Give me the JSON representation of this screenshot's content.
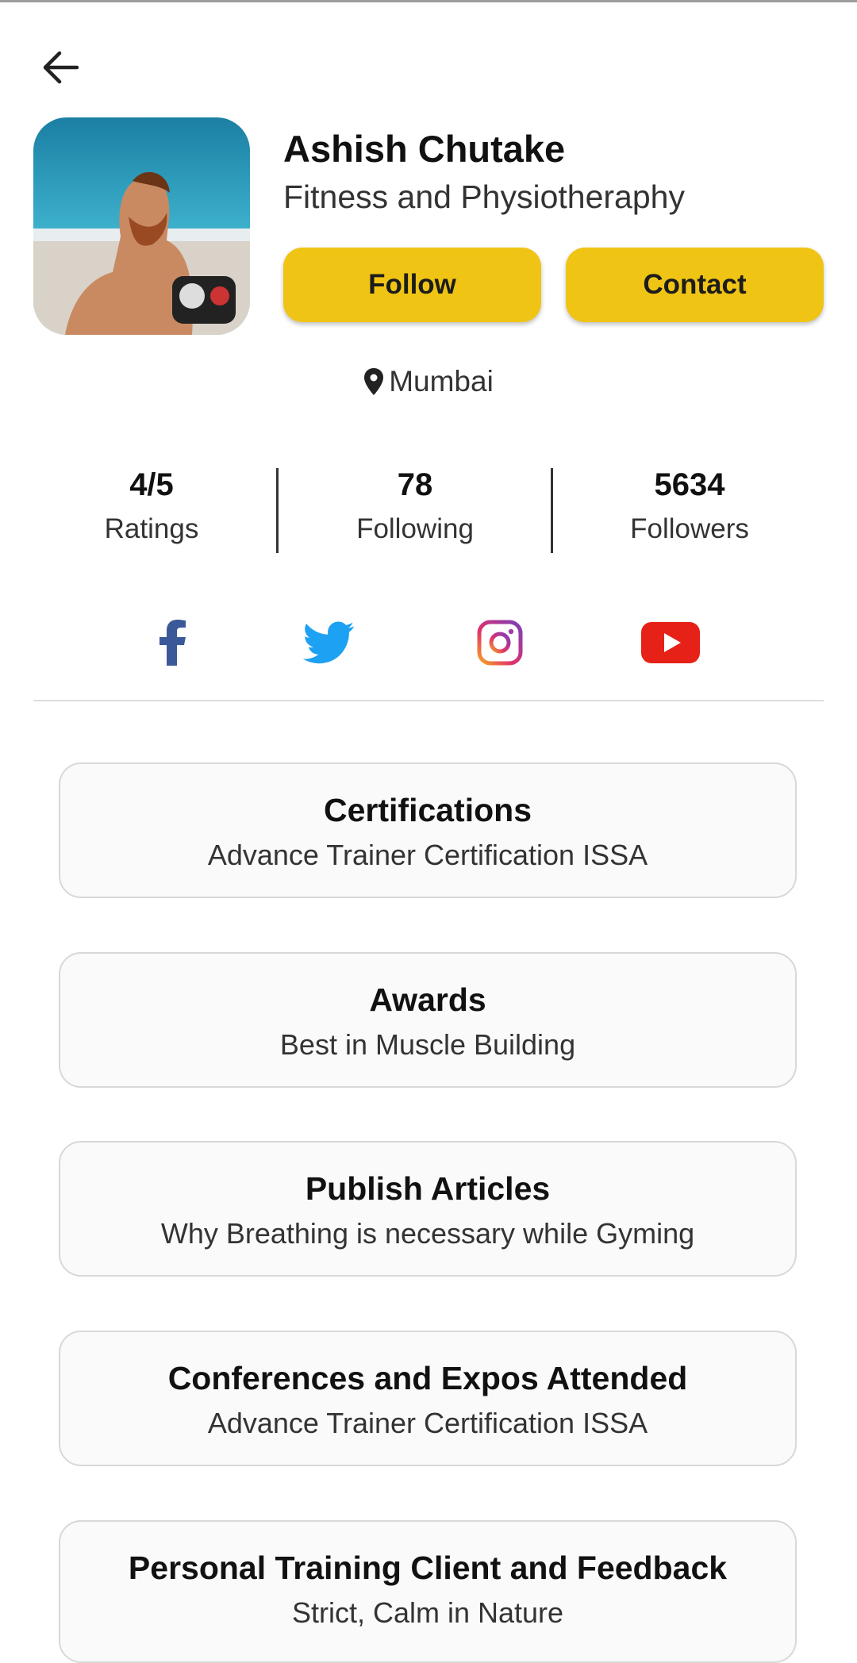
{
  "profile": {
    "name": "Ashish Chutake",
    "specialty": "Fitness and Physiotheraphy",
    "location": "Mumbai"
  },
  "actions": {
    "follow_label": "Follow",
    "contact_label": "Contact"
  },
  "stats": [
    {
      "value": "4/5",
      "label": "Ratings"
    },
    {
      "value": "78",
      "label": "Following"
    },
    {
      "value": "5634",
      "label": "Followers"
    }
  ],
  "social": [
    "facebook-icon",
    "twitter-icon",
    "instagram-icon",
    "youtube-icon"
  ],
  "colors": {
    "accent": "#f0c414",
    "facebook": "#3b5998",
    "twitter": "#1da1f2",
    "youtube": "#e62117"
  },
  "sections": [
    {
      "title": "Certifications",
      "value": "Advance Trainer Certification ISSA"
    },
    {
      "title": "Awards",
      "value": "Best in Muscle Building"
    },
    {
      "title": "Publish Articles",
      "value": "Why Breathing is necessary while Gyming"
    },
    {
      "title": "Conferences and Expos Attended",
      "value": "Advance Trainer Certification ISSA"
    },
    {
      "title": "Personal Training Client and Feedback",
      "value": "Strict, Calm in Nature"
    }
  ]
}
